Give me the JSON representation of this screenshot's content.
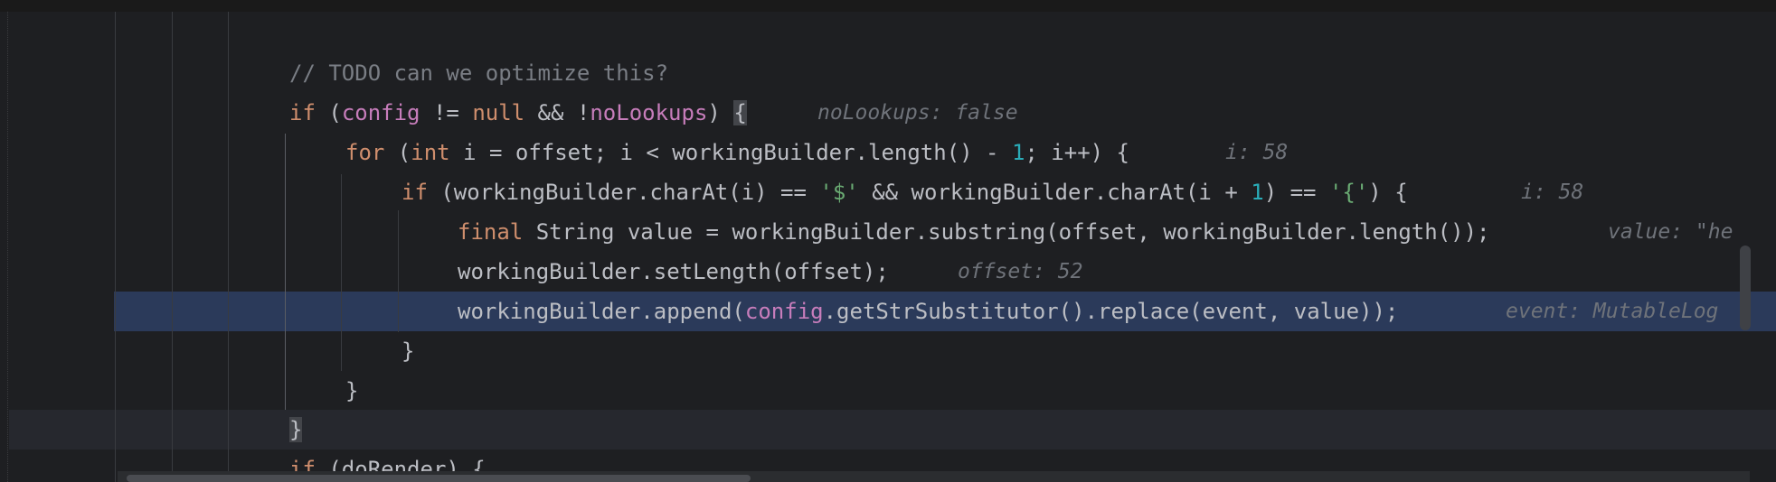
{
  "editor": {
    "lines": [
      {
        "id": "l1",
        "tokens": [
          {
            "t": "// TODO can we optimize this?",
            "c": "cmt"
          }
        ]
      },
      {
        "id": "l2",
        "tokens": [
          {
            "t": "if",
            "c": "kw"
          },
          {
            "t": " (",
            "c": ""
          },
          {
            "t": "config",
            "c": "fld"
          },
          {
            "t": " != ",
            "c": ""
          },
          {
            "t": "null",
            "c": "kw"
          },
          {
            "t": " && !",
            "c": ""
          },
          {
            "t": "noLookups",
            "c": "fld"
          },
          {
            "t": ") ",
            "c": ""
          },
          {
            "t": "{",
            "c": "brace"
          }
        ],
        "hint": "noLookups: false"
      },
      {
        "id": "l3",
        "tokens": [
          {
            "t": "for",
            "c": "kw"
          },
          {
            "t": " (",
            "c": ""
          },
          {
            "t": "int",
            "c": "kw"
          },
          {
            "t": " i = offset; i < workingBuilder.length() - ",
            "c": ""
          },
          {
            "t": "1",
            "c": "num"
          },
          {
            "t": "; i++) {",
            "c": ""
          }
        ],
        "hint": "i: 58"
      },
      {
        "id": "l4",
        "tokens": [
          {
            "t": "if",
            "c": "kw"
          },
          {
            "t": " (workingBuilder.charAt(i) == ",
            "c": ""
          },
          {
            "t": "'$'",
            "c": "str"
          },
          {
            "t": " && workingBuilder.charAt(i + ",
            "c": ""
          },
          {
            "t": "1",
            "c": "num"
          },
          {
            "t": ") == ",
            "c": ""
          },
          {
            "t": "'{'",
            "c": "str"
          },
          {
            "t": ") {",
            "c": ""
          }
        ],
        "hint": "i: 58"
      },
      {
        "id": "l5",
        "tokens": [
          {
            "t": "final",
            "c": "kw"
          },
          {
            "t": " String value = workingBuilder.substring(offset, workingBuilder.length());",
            "c": ""
          }
        ],
        "hint": "value: \"he"
      },
      {
        "id": "l6",
        "tokens": [
          {
            "t": "workingBuilder.setLength(offset);",
            "c": ""
          }
        ],
        "hint": "offset: 52"
      },
      {
        "id": "l7",
        "tokens": [
          {
            "t": "workingBuilder.append(",
            "c": ""
          },
          {
            "t": "config",
            "c": "fld"
          },
          {
            "t": ".getStrSubstitutor().replace(event, value));",
            "c": ""
          }
        ],
        "hint": "event: MutableLog"
      },
      {
        "id": "l8",
        "tokens": [
          {
            "t": "}",
            "c": ""
          }
        ]
      },
      {
        "id": "l9",
        "tokens": [
          {
            "t": "}",
            "c": ""
          }
        ]
      },
      {
        "id": "l10",
        "tokens": [
          {
            "t": "}",
            "c": "brace"
          }
        ]
      },
      {
        "id": "l11",
        "tokens": [
          {
            "t": "if",
            "c": "kw"
          },
          {
            "t": " (doRender) {",
            "c": ""
          }
        ]
      }
    ]
  },
  "colors": {
    "background": "#1e1f22",
    "execution_line": "#2b3a5a",
    "keyword": "#cf8e6d",
    "field": "#c77dbb",
    "number": "#2aacb8",
    "string": "#6aab73",
    "comment": "#7a7e85",
    "inline_hint": "#6f737a"
  }
}
